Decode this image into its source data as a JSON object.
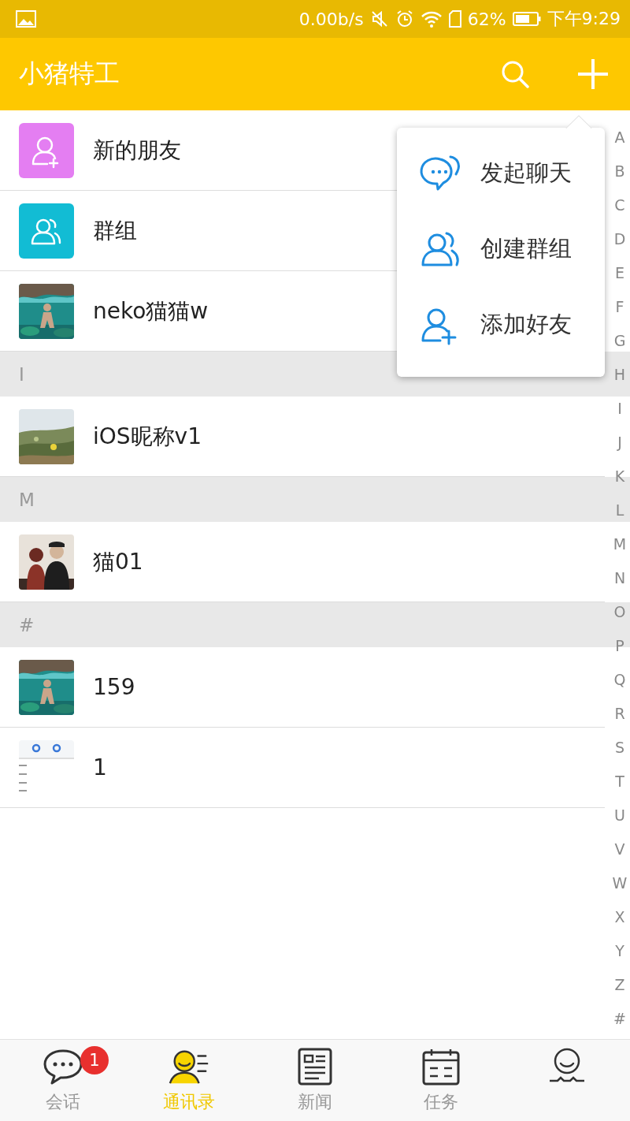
{
  "status_bar": {
    "speed": "0.00b/s",
    "battery": "62%",
    "time": "下午9:29"
  },
  "app_bar": {
    "title": "小猪特工"
  },
  "shortcuts": [
    {
      "label": "新的朋友",
      "color": "#e47ef2"
    },
    {
      "label": "群组",
      "color": "#12bcd4"
    }
  ],
  "sections": [
    {
      "entries": [
        {
          "name": "neko猫猫w"
        }
      ]
    },
    {
      "header": "I",
      "entries": [
        {
          "name": "iOS昵称v1"
        }
      ]
    },
    {
      "header": "M",
      "entries": [
        {
          "name": "猫01"
        }
      ]
    },
    {
      "header": "#",
      "entries": [
        {
          "name": "159"
        },
        {
          "name": "1",
          "kind": "screenshot"
        }
      ]
    }
  ],
  "index": [
    "A",
    "B",
    "C",
    "D",
    "E",
    "F",
    "G",
    "H",
    "I",
    "J",
    "K",
    "L",
    "M",
    "N",
    "O",
    "P",
    "Q",
    "R",
    "S",
    "T",
    "U",
    "V",
    "W",
    "X",
    "Y",
    "Z",
    "#"
  ],
  "menu": {
    "items": [
      {
        "label": "发起聊天"
      },
      {
        "label": "创建群组"
      },
      {
        "label": "添加好友"
      }
    ]
  },
  "tabs": [
    {
      "label": "会话",
      "selected": false,
      "badge": "1"
    },
    {
      "label": "通讯录",
      "selected": true
    },
    {
      "label": "新闻",
      "selected": false
    },
    {
      "label": "任务",
      "selected": false
    },
    {
      "selected": false
    }
  ]
}
